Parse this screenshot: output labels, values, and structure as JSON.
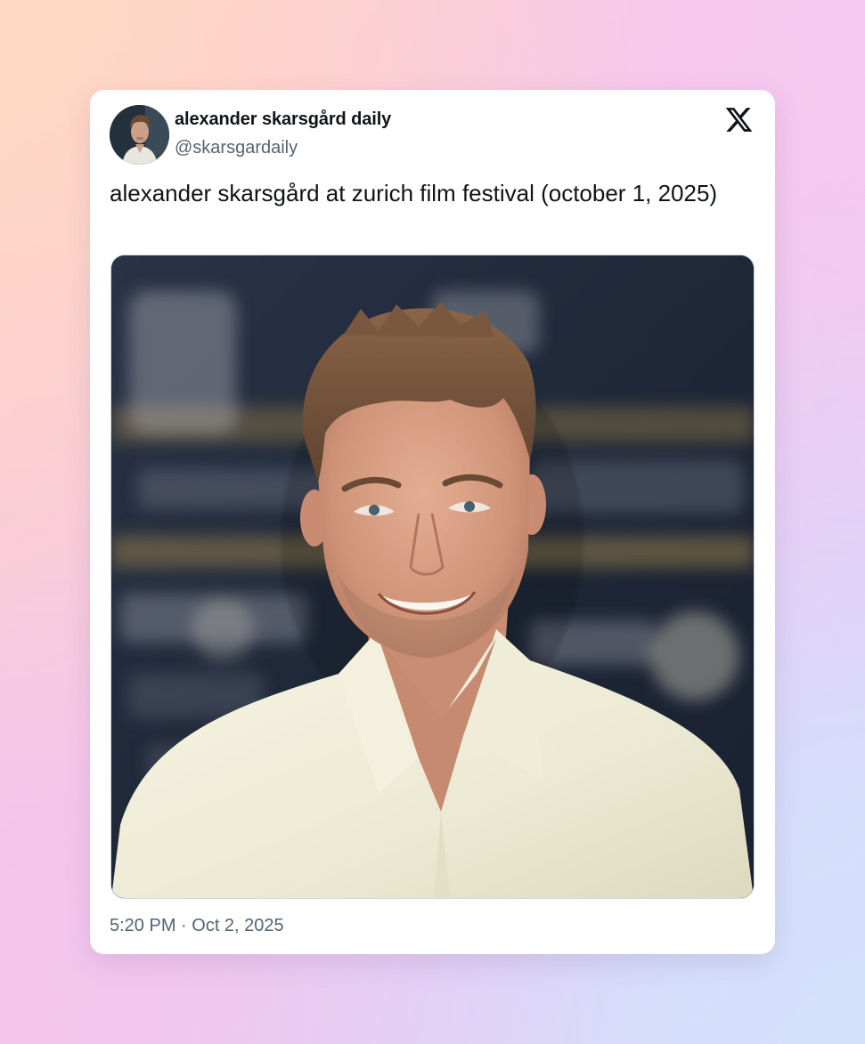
{
  "tweet": {
    "author": {
      "display_name": "alexander skarsgård daily",
      "handle": "@skarsgardaily"
    },
    "text": "alexander skarsgård at zurich film festival (october 1, 2025)",
    "timestamp": "5:20 PM · Oct 2, 2025",
    "platform_icon": "x-logo-icon",
    "media": {
      "type": "photo",
      "subject": "portrait-photo"
    }
  },
  "colors": {
    "text_primary": "#0f1419",
    "text_secondary": "#536471",
    "card_background": "#ffffff",
    "media_border": "#cfd9de"
  }
}
